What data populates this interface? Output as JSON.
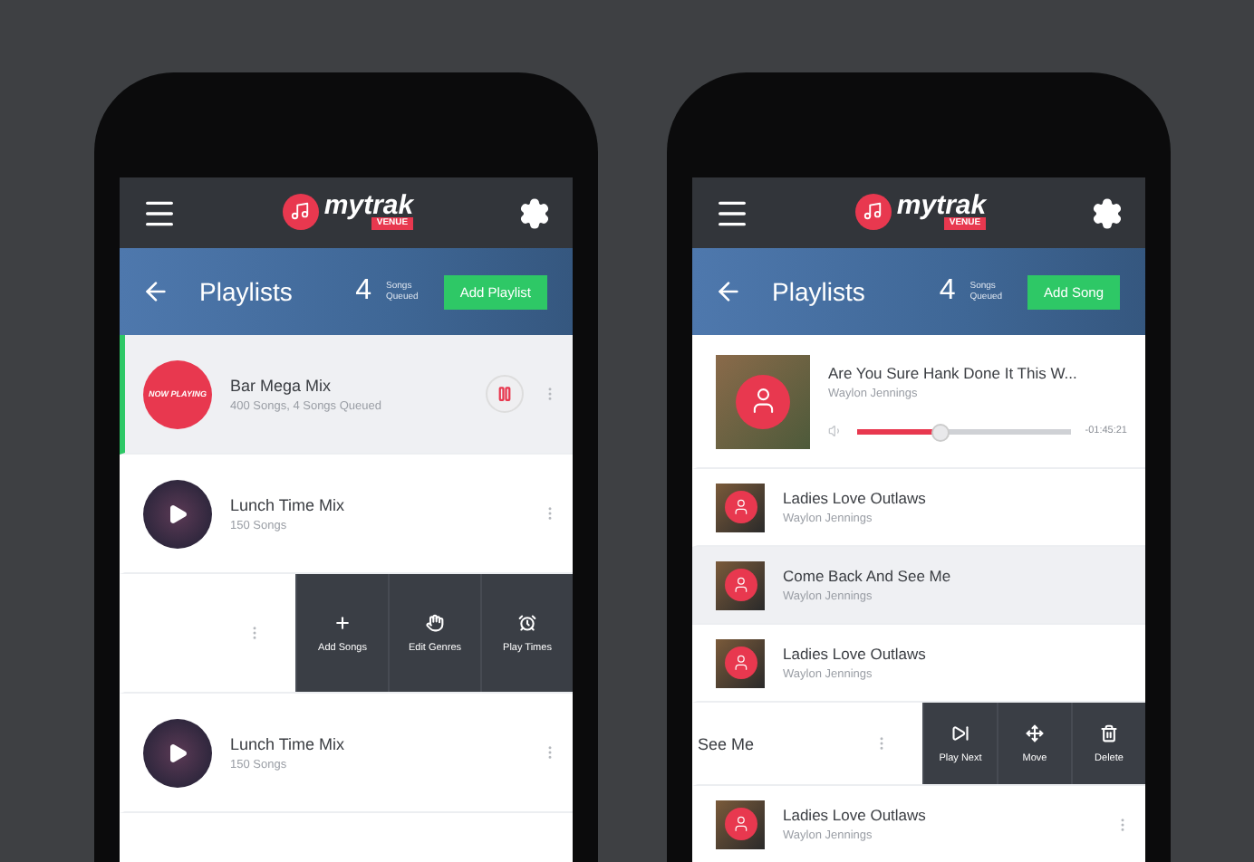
{
  "phones": [
    {
      "kind": "playlists",
      "logo": {
        "name": "mytrak",
        "tag": "VENUE"
      },
      "banner": {
        "title": "Playlists",
        "count": "4",
        "count_label_1": "Songs",
        "count_label_2": "Queued",
        "button": "Add Playlist"
      },
      "rows": [
        {
          "kind": "playlist",
          "title": "Bar Mega Mix",
          "subtitle": "400 Songs, 4 Songs Queued",
          "badge": "NOW PLAYING",
          "selected": true,
          "playing": true
        },
        {
          "kind": "playlist",
          "title": "Lunch Time Mix",
          "subtitle": "150 Songs",
          "selected": false,
          "playing": false
        },
        {
          "kind": "swiped",
          "actions": [
            {
              "kind": "add",
              "label": "Add Songs"
            },
            {
              "kind": "genres",
              "label": "Edit Genres"
            },
            {
              "kind": "times",
              "label": "Play Times"
            }
          ]
        },
        {
          "kind": "playlist",
          "title": "Lunch Time Mix",
          "subtitle": "150 Songs",
          "selected": false,
          "playing": false
        },
        {
          "kind": "blank"
        }
      ]
    },
    {
      "kind": "songs",
      "logo": {
        "name": "mytrak",
        "tag": "VENUE"
      },
      "banner": {
        "title": "Playlists",
        "count": "4",
        "count_label_1": "Songs",
        "count_label_2": "Queued",
        "button": "Add Song"
      },
      "rows": [
        {
          "kind": "now_playing",
          "title": "Are You Sure Hank Done It This W...",
          "artist": "Waylon Jennings",
          "level": 0.38,
          "time": "-01:45:21"
        },
        {
          "kind": "track",
          "title": "Ladies Love Outlaws",
          "artist": "Waylon Jennings",
          "selected": false
        },
        {
          "kind": "track",
          "title": "Come Back And See Me",
          "artist": "Waylon Jennings",
          "selected": true
        },
        {
          "kind": "track",
          "title": "Ladies Love Outlaws",
          "artist": "Waylon Jennings",
          "selected": false
        },
        {
          "kind": "swiped",
          "title": "See Me",
          "actions": [
            {
              "kind": "next",
              "label": "Play Next"
            },
            {
              "kind": "move",
              "label": "Move"
            },
            {
              "kind": "delete",
              "label": "Delete"
            }
          ]
        },
        {
          "kind": "track",
          "title": "Ladies Love Outlaws",
          "artist": "Waylon Jennings",
          "selected": false
        }
      ]
    }
  ]
}
